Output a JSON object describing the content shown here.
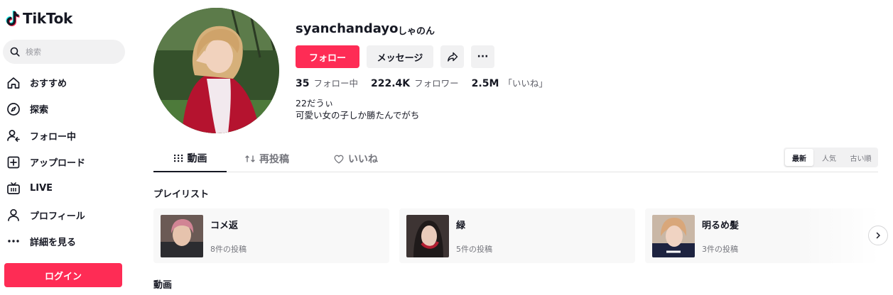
{
  "app": {
    "logo_text": "TikTok"
  },
  "search": {
    "placeholder": "検索"
  },
  "sidebar": {
    "items": [
      {
        "label": "おすすめ",
        "icon": "home-icon"
      },
      {
        "label": "探索",
        "icon": "compass-icon"
      },
      {
        "label": "フォロー中",
        "icon": "following-icon"
      },
      {
        "label": "アップロード",
        "icon": "upload-icon"
      },
      {
        "label": "LIVE",
        "icon": "live-icon"
      },
      {
        "label": "プロフィール",
        "icon": "profile-icon"
      },
      {
        "label": "詳細を見る",
        "icon": "more-icon"
      }
    ],
    "login_label": "ログイン"
  },
  "profile": {
    "username": "syanchandayo",
    "nickname": "しゃのん",
    "follow_label": "フォロー",
    "message_label": "メッセージ",
    "more_label": "···",
    "stats": [
      {
        "value": "35",
        "label": "フォロー中"
      },
      {
        "value": "222.4K",
        "label": "フォロワー"
      },
      {
        "value": "2.5M",
        "label": "「いいね」"
      }
    ],
    "bio": [
      "22だうぃ",
      "可愛い女の子しか勝たんでがち"
    ]
  },
  "tabs": [
    {
      "label": "動画",
      "icon": "grid-icon",
      "active": true
    },
    {
      "label": "再投稿",
      "icon": "repost-icon",
      "active": false
    },
    {
      "label": "いいね",
      "icon": "heart-icon",
      "active": false
    }
  ],
  "sort_options": [
    {
      "label": "最新",
      "active": true
    },
    {
      "label": "人気",
      "active": false
    },
    {
      "label": "古い順",
      "active": false
    }
  ],
  "playlists_title": "プレイリスト",
  "playlists": [
    {
      "name": "コメ返",
      "count": "8件の投稿"
    },
    {
      "name": "緑",
      "count": "5件の投稿"
    },
    {
      "name": "明るめ髪",
      "count": "3件の投稿"
    }
  ],
  "videos_title": "動画",
  "colors": {
    "accent": "#fe2c55",
    "text": "#161823",
    "muted": "#75767d",
    "button_bg": "#f1f1f2"
  }
}
